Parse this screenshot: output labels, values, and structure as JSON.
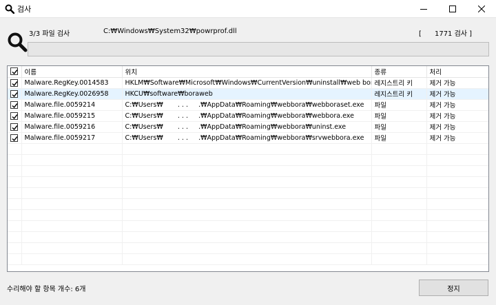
{
  "window": {
    "title": "검사",
    "controls": [
      "minimize-icon",
      "maximize-icon",
      "close-icon"
    ]
  },
  "scan": {
    "label": "3/3 파일 검사",
    "current_path": "C:₩Windows₩System32₩powrprof.dll",
    "count_text": "[      1771 검사 ]",
    "progress_percent": 0
  },
  "table": {
    "columns": [
      "",
      "이름",
      "위치",
      "종류",
      "처리"
    ],
    "rows": [
      {
        "checked": true,
        "name": "Malware.RegKey.0014583",
        "location": "HKLM₩Software₩Microsoft₩Windows₩CurrentVersion₩uninstall₩web bora",
        "type": "레지스트리 키",
        "action": "제거 가능",
        "selected": false
      },
      {
        "checked": true,
        "name": "Malware.RegKey.0026958",
        "location": "HKCU₩software₩boraweb",
        "type": "레지스트리 키",
        "action": "제거 가능",
        "selected": true
      },
      {
        "checked": true,
        "name": "Malware.file.0059214",
        "location": "C:₩Users₩       . . .     .₩AppData₩Roaming₩webbora₩webboraset.exe",
        "type": "파일",
        "action": "제거 가능",
        "selected": false
      },
      {
        "checked": true,
        "name": "Malware.file.0059215",
        "location": "C:₩Users₩       . . .     .₩AppData₩Roaming₩webbora₩webbora.exe",
        "type": "파일",
        "action": "제거 가능",
        "selected": false
      },
      {
        "checked": true,
        "name": "Malware.file.0059216",
        "location": "C:₩Users₩       . . .     .₩AppData₩Roaming₩webbora₩uninst.exe",
        "type": "파일",
        "action": "제거 가능",
        "selected": false
      },
      {
        "checked": true,
        "name": "Malware.file.0059217",
        "location": "C:₩Users₩       . . .     .₩AppData₩Roaming₩webbora₩srvwebbora.exe",
        "type": "파일",
        "action": "제거 가능",
        "selected": false
      }
    ],
    "empty_row_count": 11
  },
  "footer": {
    "summary": "수리해야 할 항목 개수: 6개",
    "stop_label": "정지"
  }
}
